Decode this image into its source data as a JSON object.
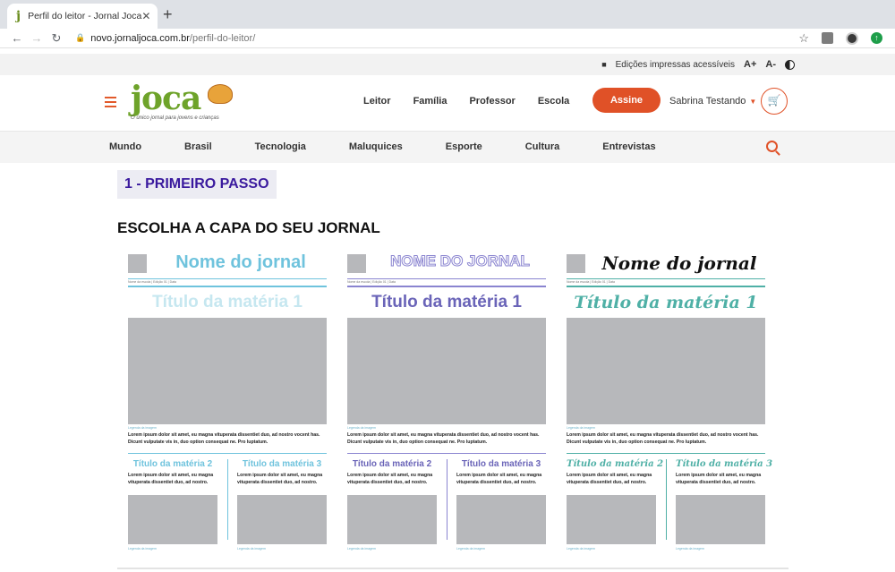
{
  "browser": {
    "tab_title": "Perfil do leitor - Jornal Joca",
    "tab_close": "✕",
    "new_tab": "+",
    "url_host": "novo.jornaljoca.com.br",
    "url_path": "/perfil-do-leitor/"
  },
  "accessibility": {
    "printed_editions": "Edições impressas acessíveis",
    "font_increase": "A+",
    "font_decrease": "A-"
  },
  "logo": {
    "wordmark": "joca",
    "tagline": "O único jornal para jovens e crianças"
  },
  "main_nav": [
    "Leitor",
    "Família",
    "Professor",
    "Escola"
  ],
  "subscribe_label": "Assine",
  "user_name": "Sabrina Testando",
  "categories": [
    "Mundo",
    "Brasil",
    "Tecnologia",
    "Maluquices",
    "Esporte",
    "Cultura",
    "Entrevistas"
  ],
  "step_label": "1 - PRIMEIRO PASSO",
  "section_title": "ESCOLHA A CAPA DO SEU JORNAL",
  "covers": [
    {
      "name": "Nome do jornal",
      "meta": "Nome da escola | Edição 01 | Data",
      "title": "Título da matéria 1",
      "caption": "Legenda da imagem",
      "body": "Lorem ipsum dolor sit amet, eu magna vituperata dissentiet duo, ad nostro vocent has. Dicunt vulputate vis in, duo option consequat ne. Pro luptatum.",
      "sub1_title": "Título da matéria 2",
      "sub2_title": "Título da matéria 3",
      "sub_text": "Lorem ipsum dolor sit amet, eu magna vituperata dissentiet duo, ad nostro.",
      "accent": "#6fc3dd",
      "title_color": "#c6e7f0"
    },
    {
      "name": "NOME DO JORNAL",
      "meta": "Nome da escola | Edição 01 | Data",
      "title": "Título da matéria 1",
      "caption": "Legenda da imagem",
      "body": "Lorem ipsum dolor sit amet, eu magna vituperata dissentiet duo, ad nostro vocent has. Dicunt vulputate vis in, duo option consequat ne. Pro luptatum.",
      "sub1_title": "Título da matéria 2",
      "sub2_title": "Título da matéria 3",
      "sub_text": "Lorem ipsum dolor sit amet, eu magna vituperata dissentiet duo, ad nostro.",
      "accent": "#8a84d0",
      "title_color": "#6a64b8"
    },
    {
      "name": "Nome do jornal",
      "meta": "Nome da escola | Edição 01 | Data",
      "title": "Título da matéria 1",
      "caption": "Legenda da imagem",
      "body": "Lorem ipsum dolor sit amet, eu magna vituperata dissentiet duo, ad nostro vocent has. Dicunt vulputate vis in, duo option consequat ne. Pro luptatum.",
      "sub1_title": "Título da matéria 2",
      "sub2_title": "Título da matéria 3",
      "sub_text": "Lorem ipsum dolor sit amet, eu magna vituperata dissentiet duo, ad nostro.",
      "accent": "#4fb0a6",
      "title_color": "#4fb0a6",
      "name_color": "#111111"
    }
  ]
}
